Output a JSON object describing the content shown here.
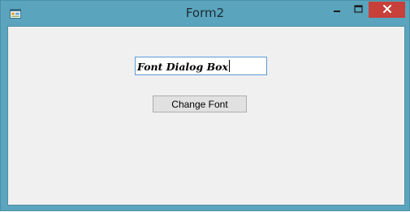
{
  "window": {
    "title": "Form2",
    "icon": "winforms-app-icon",
    "controls": {
      "minimize_icon": "minimize-icon",
      "maximize_icon": "maximize-icon",
      "close_icon": "close-icon"
    },
    "colors": {
      "frame": "#5aa5bd",
      "close": "#c7403a",
      "client": "#f0f0f0"
    }
  },
  "form": {
    "textbox_value": "Font Dialog Box",
    "button_label": "Change Font"
  }
}
